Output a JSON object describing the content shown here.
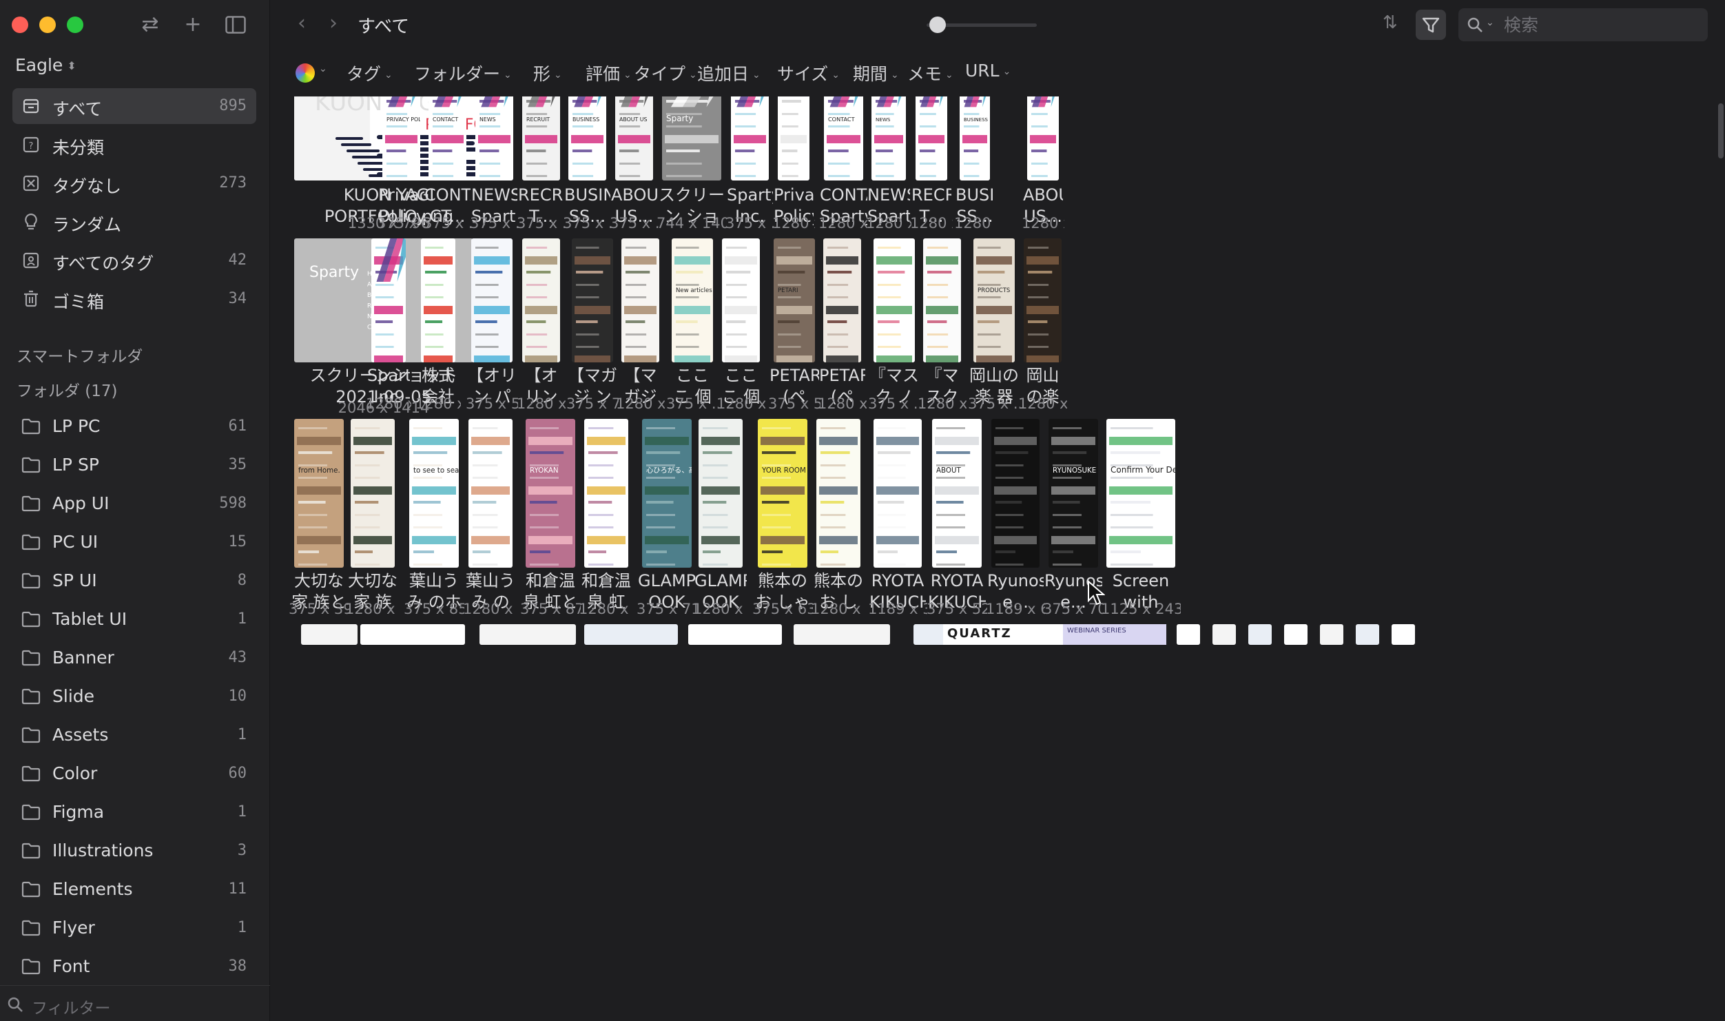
{
  "app": {
    "library": "Eagle"
  },
  "sidebar": {
    "nav": [
      {
        "label": "すべて",
        "count": "895",
        "icon": "all-items-icon",
        "active": true
      },
      {
        "label": "未分類",
        "count": "",
        "icon": "unsorted-icon"
      },
      {
        "label": "タグなし",
        "count": "273",
        "icon": "untagged-icon"
      },
      {
        "label": "ランダム",
        "count": "",
        "icon": "random-bulb-icon"
      },
      {
        "label": "すべてのタグ",
        "count": "42",
        "icon": "all-tags-icon"
      },
      {
        "label": "ゴミ箱",
        "count": "34",
        "icon": "trash-icon"
      }
    ],
    "smart_folders_heading": "スマートフォルダ",
    "folders_heading": "フォルダ (17)",
    "folders": [
      {
        "label": "LP PC",
        "count": "61"
      },
      {
        "label": "LP SP",
        "count": "35"
      },
      {
        "label": "App UI",
        "count": "598"
      },
      {
        "label": "PC UI",
        "count": "15"
      },
      {
        "label": "SP UI",
        "count": "8"
      },
      {
        "label": "Tablet UI",
        "count": "1"
      },
      {
        "label": "Banner",
        "count": "43"
      },
      {
        "label": "Slide",
        "count": "10"
      },
      {
        "label": "Assets",
        "count": "1"
      },
      {
        "label": "Color",
        "count": "60"
      },
      {
        "label": "Figma",
        "count": "1"
      },
      {
        "label": "Illustrations",
        "count": "3"
      },
      {
        "label": "Elements",
        "count": "11"
      },
      {
        "label": "Flyer",
        "count": "1"
      },
      {
        "label": "Font",
        "count": "38"
      }
    ],
    "filter_placeholder": "フィルター"
  },
  "toolbar": {
    "breadcrumb": "すべて",
    "search_placeholder": "検索",
    "zoom_level": 0.05
  },
  "filters": [
    "タグ",
    "フォルダー",
    "形",
    "評価",
    "タイプ",
    "追加日",
    "サイズ",
    "期間",
    "メモ",
    "URL"
  ],
  "grid": {
    "row1": [
      {
        "name": "KUON YAGI PORTFOLIO.png",
        "size": "1330 x 796",
        "style": "kuon",
        "title": "KUON YAGI",
        "subtitle": "PORTFOLIO"
      },
      {
        "name": "Privacy Policy..",
        "size": "375 x ...",
        "style": "sparty-w",
        "label": "PRIVACY POLICY"
      },
      {
        "name": "CONTA CT...",
        "size": "375 x ...",
        "style": "sparty-w",
        "label": "CONTACT"
      },
      {
        "name": "NEWS Spart...",
        "size": "375 x ...",
        "style": "sparty-w",
        "label": "NEWS"
      },
      {
        "name": "RECRUI T...",
        "size": "375 x ...",
        "style": "sparty-photo",
        "label": "RECRUIT"
      },
      {
        "name": "BUSINE SS...",
        "size": "375 x ...",
        "style": "sparty-w",
        "label": "BUSINESS"
      },
      {
        "name": "ABOUT US...",
        "size": "375 x ...",
        "style": "sparty-photo",
        "label": "ABOUT US"
      },
      {
        "name": "スクリーン ショット...",
        "size": "744 x 1408",
        "style": "sparty-grey",
        "label": "Sparty"
      },
      {
        "name": "Sparty, Inc. ...",
        "size": "375 x ...",
        "style": "sparty-w",
        "label": ""
      },
      {
        "name": "Privacy Policy..",
        "size": "1280 x...",
        "style": "doc",
        "label": ""
      },
      {
        "name": "CONTACT Sparty,...",
        "size": "1280 x 2...",
        "style": "sparty-w",
        "label": "CONTACT"
      },
      {
        "name": "NEWS Sparty,...",
        "size": "1280 x...",
        "style": "sparty-w",
        "label": "NEWS"
      },
      {
        "name": "RECRUI T...",
        "size": "1280 x...",
        "style": "sparty-w",
        "label": ""
      },
      {
        "name": "BUSINE SS...",
        "size": "1280 x...",
        "style": "sparty-w",
        "label": "BUSINESS"
      },
      {
        "name": "ABOUT US...",
        "size": "1280 x...",
        "style": "sparty-w",
        "label": ""
      }
    ],
    "row2": [
      {
        "name": "スクリーンショット 2021-09-05 17.33.40.png",
        "size": "2046 x 1414",
        "style": "sparty-menu",
        "brand": "Sparty",
        "menu": [
          "HOME",
          "ABOUT US",
          "BUSINESS",
          "RECRUIT",
          "NEWS",
          "CONTACT"
        ]
      },
      {
        "name": "Sparty, Inc. パ...",
        "size": "1280 x ...",
        "style": "sparty-w",
        "label": ""
      },
      {
        "name": "株式会社 ビタミ...",
        "size": "1280 x ...",
        "style": "green",
        "label": ""
      },
      {
        "name": "【オリン パス公...",
        "size": "375 x 5...",
        "style": "blue",
        "label": ""
      },
      {
        "name": "【オリン パス公...",
        "size": "1280 x ...",
        "style": "grid",
        "label": ""
      },
      {
        "name": "【マガジ ンど】...",
        "size": "375 x 7...",
        "style": "face",
        "label": ""
      },
      {
        "name": "【マガジ ンど】...",
        "size": "1280 x ...",
        "style": "face2",
        "label": ""
      },
      {
        "name": "ここ こ 個と個...",
        "size": "375 x ...",
        "style": "cream",
        "label": "New articles"
      },
      {
        "name": "こここ 個と個...",
        "size": "1280 x ...",
        "style": "doc",
        "label": ""
      },
      {
        "name": "PETARI (ペタ...",
        "size": "375 x 5...",
        "style": "brown",
        "label": "PETARI"
      },
      {
        "name": "PETARI (ペタ...",
        "size": "1280 x ...",
        "style": "brown2",
        "label": ""
      },
      {
        "name": "『マスク ノイエ...",
        "size": "375 x ...",
        "style": "floral",
        "label": ""
      },
      {
        "name": "『マスク ノイエ...",
        "size": "1280 x ...",
        "style": "floral2",
        "label": ""
      },
      {
        "name": "岡山の楽 器とお...",
        "size": "375 x ...",
        "style": "warm",
        "label": "PRODUCTS"
      },
      {
        "name": "岡山の楽 器とお...",
        "size": "1280 x ...",
        "style": "warm2",
        "label": ""
      }
    ],
    "row3": [
      {
        "name": "大切な家 族と自...",
        "size": "375 x 39...",
        "style": "bottles",
        "label": "from Home."
      },
      {
        "name": "大切な家 族と自...",
        "size": "1280 x 4...",
        "style": "bottles2",
        "label": ""
      },
      {
        "name": "葉山うみ のホテ...",
        "size": "375 x 85...",
        "style": "sea",
        "label": "to see to sea"
      },
      {
        "name": "葉山うみ のホテ...",
        "size": "1280 x 9...",
        "style": "sea2",
        "label": ""
      },
      {
        "name": "和倉温泉 虹と海...",
        "size": "375 x 87...",
        "style": "ryokan",
        "label": "RYOKAN"
      },
      {
        "name": "和倉温泉 虹と海...",
        "size": "1280 x 9...",
        "style": "ryokan2",
        "label": ""
      },
      {
        "name": "GLAMPR OOK 飯...",
        "size": "375 x 71...",
        "style": "lake",
        "label": "心ひろがる、高原の旅。"
      },
      {
        "name": "GLAMPR OOK 飯...",
        "size": "1280 x 7...",
        "style": "lake2",
        "label": ""
      },
      {
        "name": "熊本のお しゃれ...",
        "size": "375 x 63...",
        "style": "yellow",
        "label": "YOUR ROOM"
      },
      {
        "name": "熊本のお しゃれ...",
        "size": "1280 x 7...",
        "style": "yellow2",
        "label": ""
      },
      {
        "name": "RYOTA KIKUCH...",
        "size": "1189 x 3...",
        "style": "white-portrait",
        "label": ""
      },
      {
        "name": "RYOTA KIKUCH...",
        "size": "375 x 52...",
        "style": "white-portrait2",
        "label": "ABOUT"
      },
      {
        "name": "Ryunosuk e...",
        "size": "1189 x 6...",
        "style": "dark",
        "label": ""
      },
      {
        "name": "Ryunosuk e...",
        "size": "375 x 70...",
        "style": "dark2",
        "label": "RYUNOSUKE KINOSHITA"
      },
      {
        "name": "Screen with Account...",
        "size": "1125 x 2436",
        "style": "form",
        "label": "Confirm Your Details"
      }
    ],
    "row4_labels": [
      "QUARTZ",
      "WEBINAR SERIES"
    ]
  }
}
